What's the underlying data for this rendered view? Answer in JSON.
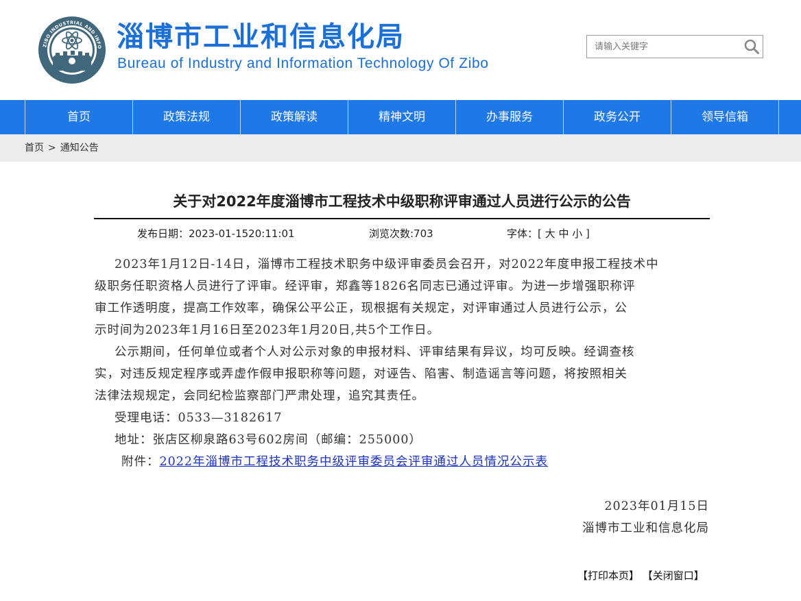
{
  "header": {
    "title_cn": "淄博市工业和信息化局",
    "title_en": "Bureau of Industry and Information Technology Of Zibo",
    "logo_text": "ZIBO INDUSTRIAL AND INFORMATION BUREAU · 淄博市工业和信息化局"
  },
  "search": {
    "placeholder": "请输入关键字",
    "icon": "search-icon"
  },
  "nav": {
    "items": [
      {
        "label": "首页"
      },
      {
        "label": "政策法规"
      },
      {
        "label": "政策解读"
      },
      {
        "label": "精神文明"
      },
      {
        "label": "办事服务"
      },
      {
        "label": "政务公开"
      },
      {
        "label": "领导信箱"
      }
    ]
  },
  "breadcrumb": {
    "home": "首页",
    "separator": ">",
    "current": "通知公告"
  },
  "article": {
    "title": "关于对2022年度淄博市工程技术中级职称评审通过人员进行公示的公告",
    "publish_date": "发布日期：2023-01-1520:11:01",
    "views": "浏览次数:703",
    "font_size": {
      "label": "字体：[",
      "large": "大",
      "medium": "中",
      "small": "小",
      "close": "]"
    },
    "paragraph1": [
      "2023年1月12日-14日，淄博市工程技术职务中级评审委员会召开，对2022年度申报工程技术中",
      "级职务任职资格人员进行了评审。经评审，郑鑫等1826名同志已通过评审。为进一步增强职称评",
      "审工作透明度，提高工作效率，确保公平公正，现根据有关规定，对评审通过人员进行公示，公",
      "示时间为2023年1月16日至2023年1月20日,共5个工作日。"
    ],
    "paragraph2": [
      "公示期间，任何单位或者个人对公示对象的申报材料、评审结果有异议，均可反映。经调查核",
      "实，对违反规定程序或弄虚作假申报职称等问题，对诬告、陷害、制造谣言等问题，将按照相关",
      "法律法规规定，会同纪检监察部门严肃处理，追究其责任。"
    ],
    "phone": "受理电话：0533—3182617",
    "address": "地址：张店区柳泉路63号602房间（邮编：255000）",
    "attachment_label": "附件：",
    "attachment_link": "2022年淄博市工程技术职务中级评审委员会评审通过人员情况公示表",
    "sign_date": "2023年01月15日",
    "sign_org": "淄博市工业和信息化局"
  },
  "actions": {
    "print": "【打印本页】",
    "close": "【关闭窗口】"
  },
  "colors": {
    "brand": "#1a6fd8",
    "nav_bg": "#1f78e8",
    "crumb_bg": "#ececec",
    "link": "#1b32c4"
  }
}
